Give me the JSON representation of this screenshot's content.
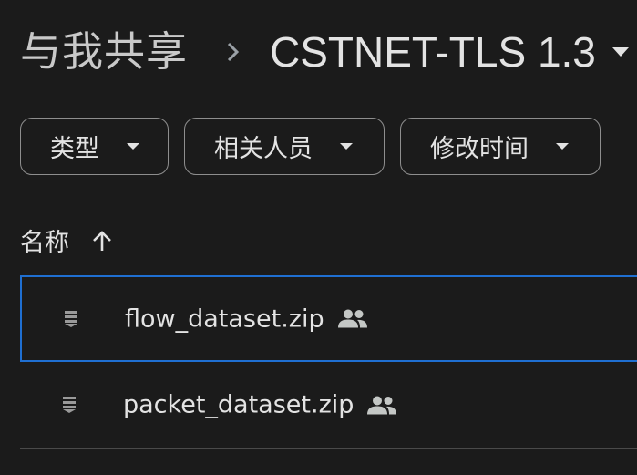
{
  "breadcrumb": {
    "root": "与我共享",
    "separator_icon": "chevron-right-icon",
    "current": "CSTNET-TLS 1.3",
    "current_icon": "caret-down-icon"
  },
  "filters": [
    {
      "label": "类型",
      "icon": "caret-down-icon"
    },
    {
      "label": "相关人员",
      "icon": "caret-down-icon"
    },
    {
      "label": "修改时间",
      "icon": "caret-down-icon"
    }
  ],
  "list_header": {
    "name_label": "名称",
    "sort_icon": "arrow-up-icon"
  },
  "files": [
    {
      "name": "flow_dataset.zip",
      "type_icon": "zip-file-icon",
      "shared_icon": "people-icon",
      "selected": true
    },
    {
      "name": "packet_dataset.zip",
      "type_icon": "zip-file-icon",
      "shared_icon": "people-icon",
      "selected": false
    }
  ],
  "colors": {
    "background": "#1b1b1b",
    "text": "#e3e3e3",
    "selection_border": "#1f6fd1",
    "chip_border": "#8e8e8e"
  }
}
